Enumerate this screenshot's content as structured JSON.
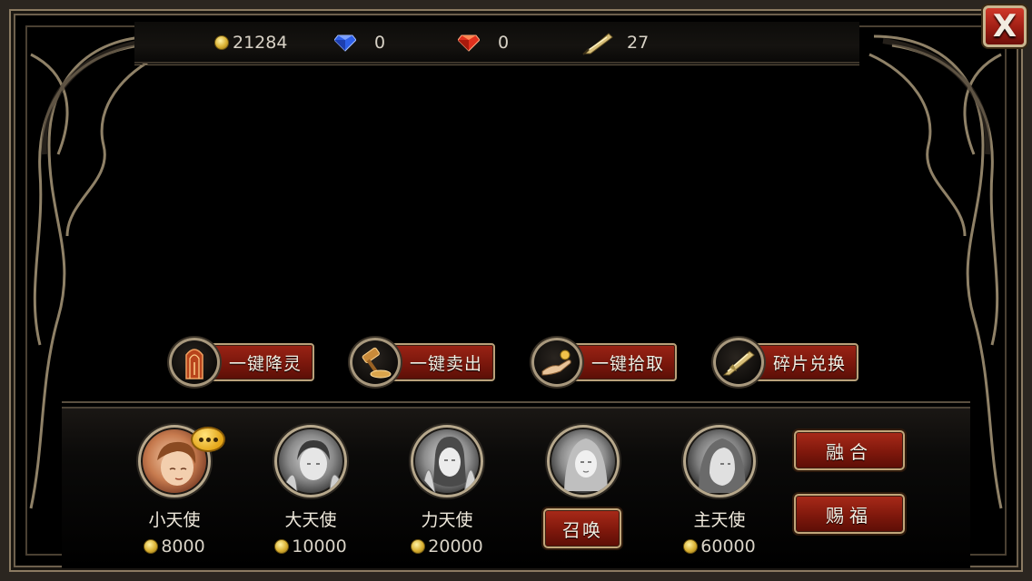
{
  "currencies": {
    "gold": "21284",
    "blue_gem": "0",
    "red_gem": "0",
    "fragments": "27"
  },
  "close_label": "X",
  "actions": [
    {
      "label": "一键降灵",
      "icon": "altar-icon"
    },
    {
      "label": "一键卖出",
      "icon": "gavel-icon"
    },
    {
      "label": "一键拾取",
      "icon": "hand-coin-icon"
    },
    {
      "label": "碎片兑换",
      "icon": "quill-icon"
    }
  ],
  "angels": [
    {
      "name": "小天使",
      "price": "8000"
    },
    {
      "name": "大天使",
      "price": "10000"
    },
    {
      "name": "力天使",
      "price": "20000"
    },
    {
      "name": "主天使",
      "price": "60000"
    }
  ],
  "summon_label": "召唤",
  "fuse_label": "融合",
  "bless_label": "赐福",
  "colors": {
    "button_red": "#8a1d10",
    "gold_border": "#b9a17a",
    "bubble_yellow": "#e4a618"
  }
}
